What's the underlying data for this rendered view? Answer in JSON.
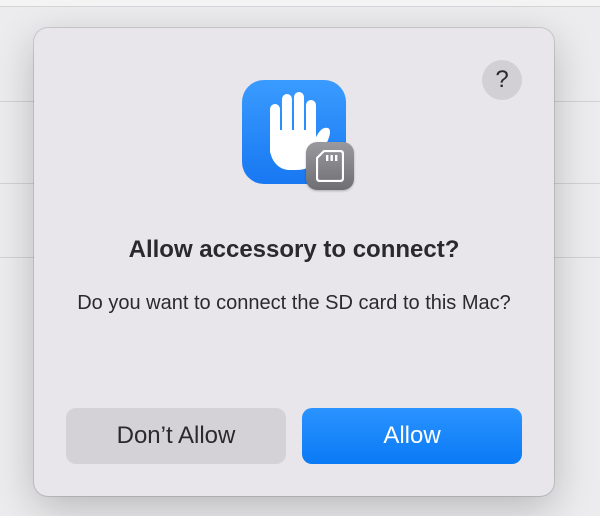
{
  "dialog": {
    "title": "Allow accessory to connect?",
    "message": "Do you want to connect the SD card to this Mac?",
    "help_label": "?",
    "icon": "hand-raised-icon",
    "badge_icon": "sd-card-icon",
    "accent_color": "#0a7af5"
  },
  "buttons": {
    "dont_allow": "Don’t Allow",
    "allow": "Allow"
  }
}
